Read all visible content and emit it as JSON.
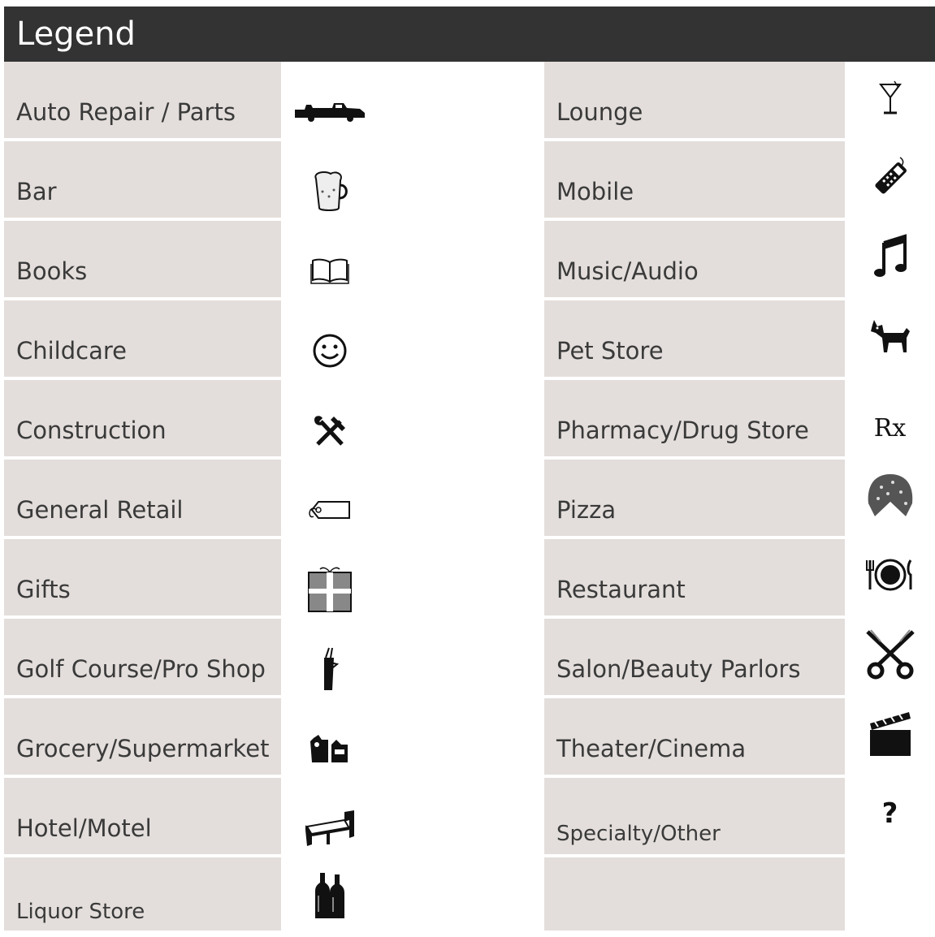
{
  "header": {
    "title": "Legend"
  },
  "left_column": [
    {
      "label": "Auto Repair / Parts",
      "icon": "car-icon"
    },
    {
      "label": "Bar",
      "icon": "beer-mug-icon"
    },
    {
      "label": "Books",
      "icon": "open-book-icon"
    },
    {
      "label": "Childcare",
      "icon": "smiley-face-icon"
    },
    {
      "label": "Construction",
      "icon": "hammer-wrench-icon"
    },
    {
      "label": "General Retail",
      "icon": "price-tag-icon"
    },
    {
      "label": "Gifts",
      "icon": "gift-box-icon"
    },
    {
      "label": "Golf Course/Pro Shop",
      "icon": "golf-bag-icon"
    },
    {
      "label": "Grocery/Supermarket",
      "icon": "grocery-bags-icon"
    },
    {
      "label": "Hotel/Motel",
      "icon": "bed-icon"
    },
    {
      "label": "Liquor Store",
      "icon": "bottles-icon"
    }
  ],
  "right_column": [
    {
      "label": "Lounge",
      "icon": "cocktail-glass-icon"
    },
    {
      "label": "Mobile",
      "icon": "cell-phone-icon"
    },
    {
      "label": "Music/Audio",
      "icon": "music-note-icon"
    },
    {
      "label": "Pet Store",
      "icon": "dog-icon"
    },
    {
      "label": "Pharmacy/Drug Store",
      "icon": "rx-icon",
      "glyph": "Rx"
    },
    {
      "label": "Pizza",
      "icon": "pizza-icon"
    },
    {
      "label": "Restaurant",
      "icon": "plate-fork-knife-icon"
    },
    {
      "label": "Salon/Beauty Parlors",
      "icon": "scissors-icon"
    },
    {
      "label": "Theater/Cinema",
      "icon": "clapperboard-icon"
    },
    {
      "label": "Specialty/Other",
      "icon": "question-mark-icon",
      "glyph": "?"
    }
  ]
}
